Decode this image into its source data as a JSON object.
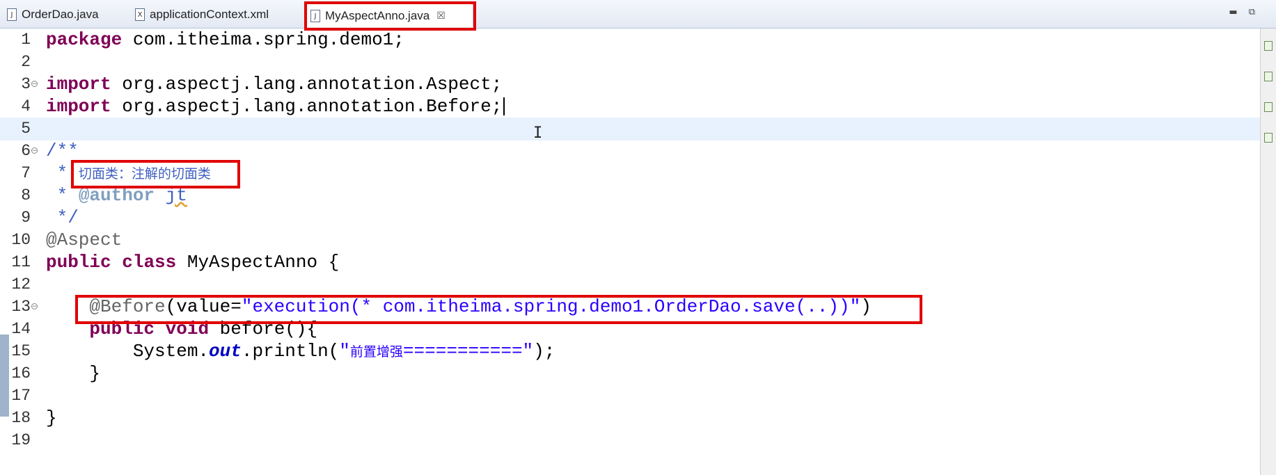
{
  "tabs": [
    {
      "label": "OrderDao.java",
      "icon": "java-file-icon",
      "glyph": "J"
    },
    {
      "label": "applicationContext.xml",
      "icon": "xml-file-icon",
      "glyph": "X"
    },
    {
      "label": "MyAspectAnno.java",
      "icon": "java-file-icon",
      "glyph": "J",
      "active": true
    }
  ],
  "tab_close_glyph": "☒",
  "window_buttons": {
    "minimize": "▬",
    "restore": "⧉"
  },
  "line_numbers": [
    "1",
    "2",
    "3",
    "4",
    "5",
    "6",
    "7",
    "8",
    "9",
    "10",
    "11",
    "12",
    "13",
    "14",
    "15",
    "16",
    "17",
    "18",
    "19"
  ],
  "code": {
    "l1": {
      "kw": "package",
      "rest": " com.itheima.spring.demo1;"
    },
    "l3": {
      "kw": "import",
      "rest": " org.aspectj.lang.annotation.Aspect;"
    },
    "l4": {
      "kw": "import",
      "rest": " org.aspectj.lang.annotation.Before;"
    },
    "l6": "/**",
    "l7": {
      "star": " * ",
      "text": "切面类：注解的切面类"
    },
    "l8": {
      "star": " * ",
      "tag": "@author",
      "sp": " ",
      "name": "jt"
    },
    "l9": " */",
    "l10": "@Aspect",
    "l11": {
      "kw1": "public",
      "sp": " ",
      "kw2": "class",
      "rest": " MyAspectAnno {"
    },
    "l13": {
      "indent": "    ",
      "an": "@Before",
      "p1": "(value=",
      "str": "\"execution(* com.itheima.spring.demo1.OrderDao.save(..))\"",
      "p2": ")"
    },
    "l14": {
      "indent": "    ",
      "kw1": "public",
      "sp": " ",
      "kw2": "void",
      "rest": " before(){"
    },
    "l15": {
      "indent": "        System.",
      "field": "out",
      "mid": ".println(",
      "str_open": "\"",
      "str_cjk": "前置增强",
      "str_rest": "===========\"",
      "end": ");"
    },
    "l16": "    }",
    "l18": "}"
  },
  "colors": {
    "keyword": "#7f0055",
    "comment": "#3f5fbf",
    "javadoc_tag": "#7f9fbf",
    "annotation": "#646464",
    "string": "#2a00ff",
    "static_field": "#0000c0",
    "highlight_box": "#e00000",
    "current_line": "#e8f2fe"
  }
}
